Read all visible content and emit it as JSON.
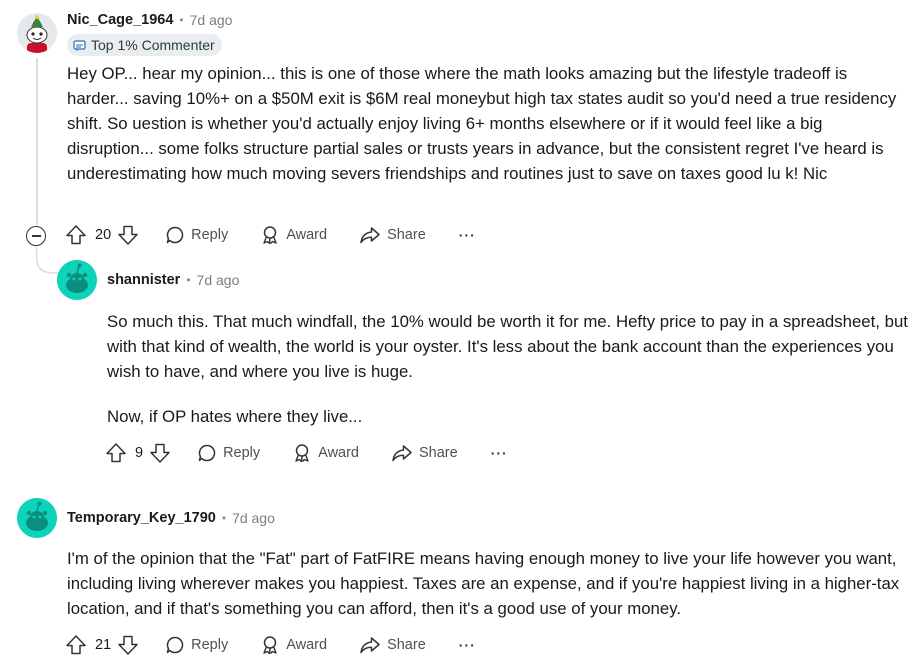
{
  "comments": [
    {
      "author": "Nic_Cage_1964",
      "time": "7d ago",
      "flair": "Top 1% Commenter",
      "body": [
        "Hey OP... hear my opinion... this is one of those where the math looks amazing but the lifestyle tradeoff is harder... saving 10%+ on a $50M exit is $6M real moneybut high tax states audit so you'd need a true residency shift. So uestion is whether you'd actually enjoy living 6+ months elsewhere or if it would feel like a big disruption... some folks structure partial sales or trusts years in advance, but the consistent regret I've heard is underestimating how much moving severs friendships and routines just to save on taxes good lu k! Nic"
      ],
      "votes": "20",
      "reply_label": "Reply",
      "award_label": "Award",
      "share_label": "Share",
      "more_label": "···"
    },
    {
      "author": "shannister",
      "time": "7d ago",
      "body": [
        "So much this. That much windfall, the 10% would be worth it for me. Hefty price to pay in a spreadsheet, but with that kind of wealth, the world is your oyster. It's less about the bank account than the experiences you wish to have, and where you live is huge.",
        "Now, if OP hates where they live..."
      ],
      "votes": "9",
      "reply_label": "Reply",
      "award_label": "Award",
      "share_label": "Share",
      "more_label": "···"
    },
    {
      "author": "Temporary_Key_1790",
      "time": "7d ago",
      "body": [
        "I'm of the opinion that the \"Fat\" part of FatFIRE means having enough money to live your life however you want, including living wherever makes you happiest. Taxes are an expense, and if you're happiest living in a higher-tax location, and if that's something you can afford, then it's a good use of your money."
      ],
      "votes": "21",
      "reply_label": "Reply",
      "award_label": "Award",
      "share_label": "Share",
      "more_label": "···"
    }
  ],
  "separator": "•",
  "colors": {
    "snoo_teal": "#0dd3bb",
    "snoo_dark": "#0a8f7f",
    "text": "#1a1a1b",
    "meta": "#7c7c7c"
  }
}
